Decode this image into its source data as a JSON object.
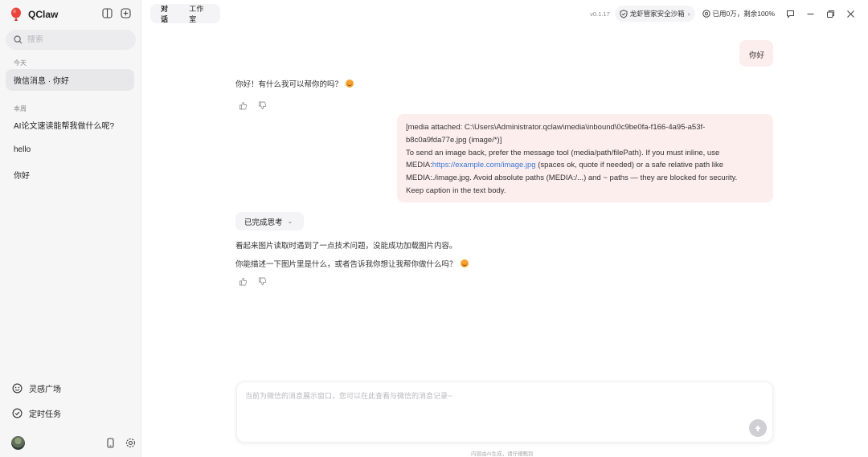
{
  "app": {
    "name": "QClaw"
  },
  "sidebar": {
    "search_placeholder": "搜索",
    "groups": [
      {
        "label": "今天",
        "items": [
          {
            "title": "微信消息 · 你好",
            "active": true
          }
        ]
      },
      {
        "label": "本周",
        "items": [
          {
            "title": "AI论文速读能帮我做什么呢?"
          },
          {
            "title": "hello"
          },
          {
            "title": "你好"
          }
        ]
      }
    ],
    "bottom_items": [
      {
        "label": "灵感广场"
      },
      {
        "label": "定时任务"
      }
    ]
  },
  "header": {
    "tabs": [
      {
        "label": "对话",
        "active": true
      },
      {
        "label": "工作室"
      }
    ],
    "version": "v0.1.17",
    "sandbox": "龙虾管家安全沙箱",
    "usage": "已用0万，剩余100%"
  },
  "chat": {
    "messages": [
      {
        "role": "user",
        "text": "你好"
      },
      {
        "role": "assistant",
        "text": "你好！有什么我可以帮你的吗？"
      },
      {
        "role": "user",
        "lines": [
          "[media attached: C:\\Users\\Administrator.qclaw\\media\\inbound\\0c9be0fa-f166-4a95-a53f-",
          "b8c0a9fda77e.jpg (image/*)]",
          "To send an image back, prefer the message tool (media/path/filePath). If you must inline, use",
          "MEDIA:",
          "https://example.com/image.jpg",
          " (spaces ok, quote if needed) or a safe relative path like",
          "MEDIA:./image.jpg. Avoid absolute paths (MEDIA:/...) and ~ paths — they are blocked for security.",
          "Keep caption in the text body."
        ]
      },
      {
        "role": "assistant",
        "thinking_label": "已完成思考",
        "paragraphs": [
          "看起来图片读取时遇到了一点技术问题，没能成功加载图片内容。",
          "你能描述一下图片里是什么，或者告诉我你想让我帮你做什么吗？"
        ]
      }
    ]
  },
  "composer": {
    "placeholder": "当前为微信的消息展示窗口，您可以在此查看与微信的消息记录~"
  },
  "footer": {
    "note": "内容由AI生成，请仔细甄别"
  },
  "colors": {
    "user_bubble": "#fdeeee",
    "link": "#3a78d4",
    "sidebar_bg": "#f6f6f7"
  }
}
